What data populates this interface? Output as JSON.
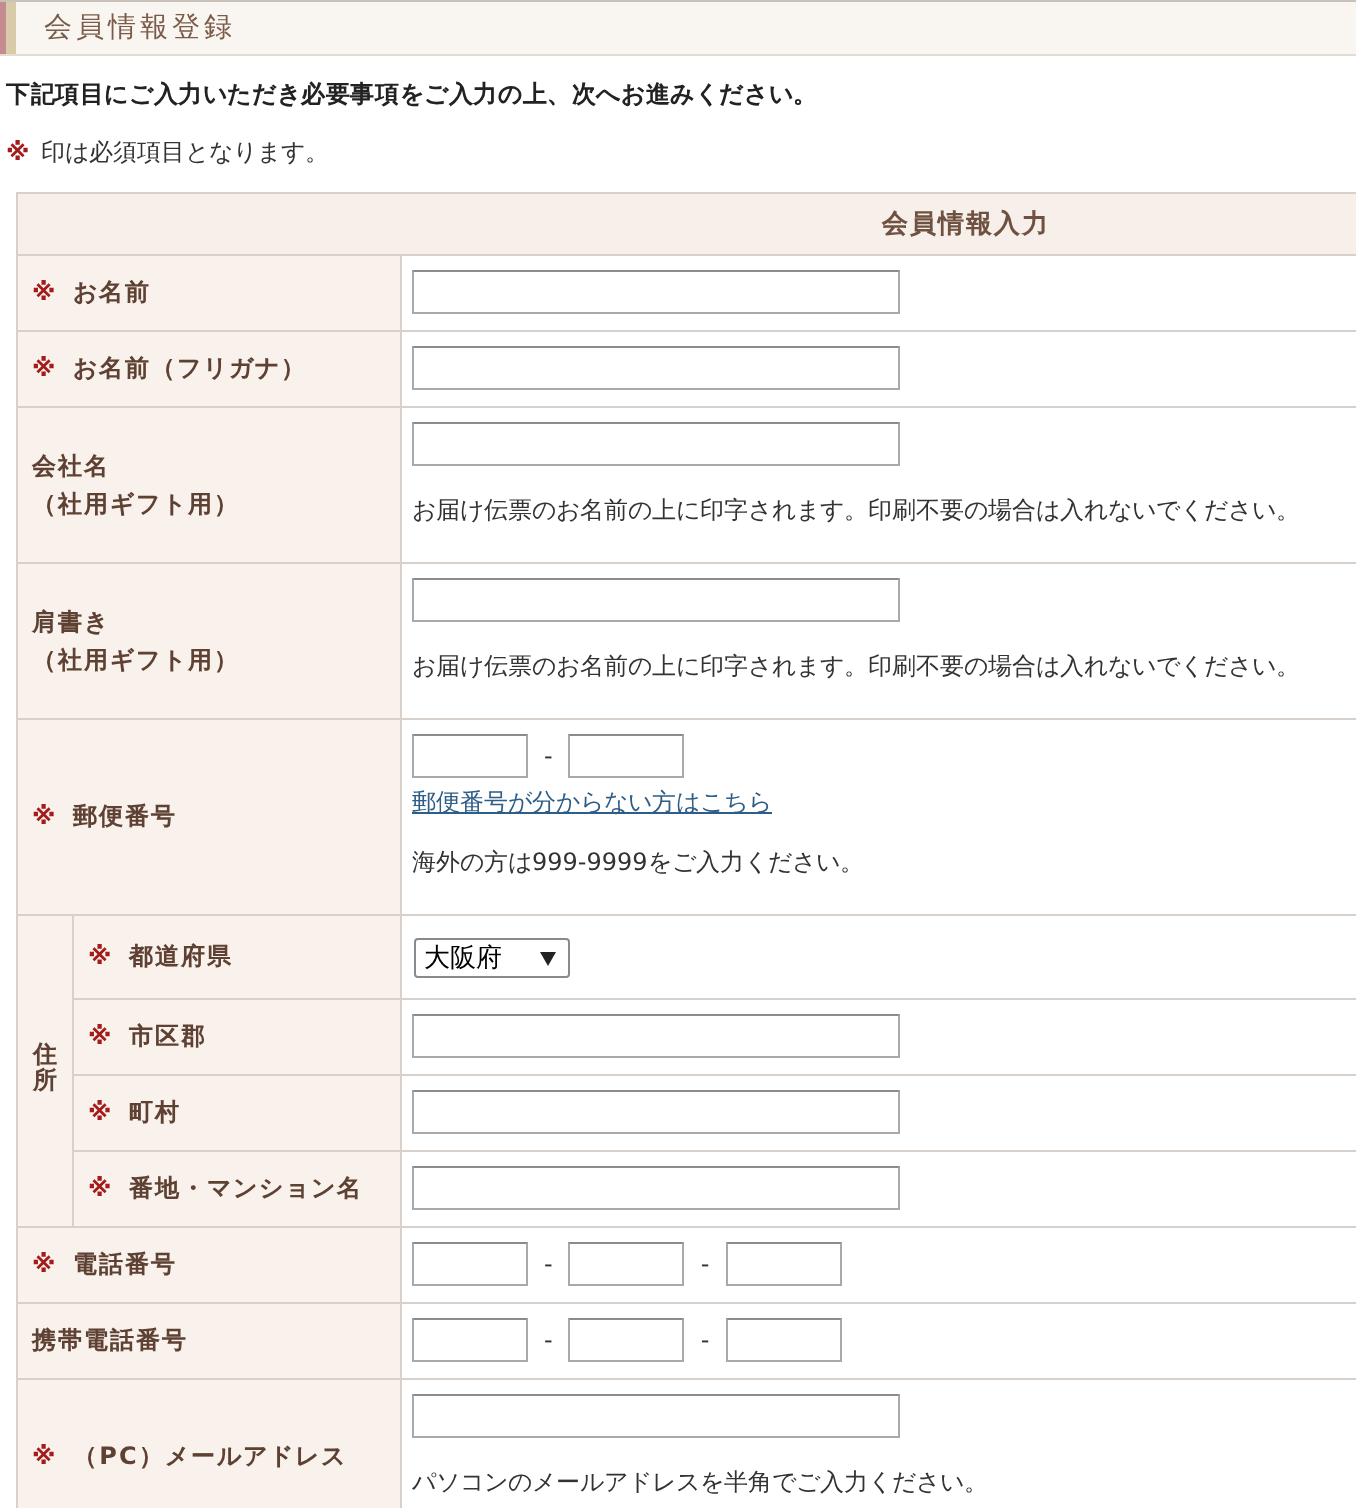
{
  "page_header": {
    "title": "会員情報登録"
  },
  "intro": "下記項目にご入力いただき必要事項をご入力の上、次へお進みください。",
  "required_note": {
    "mark": "※",
    "text": "印は必須項目となります。"
  },
  "form": {
    "heading": "会員情報入力",
    "rows": [
      {
        "kind": "text",
        "required_mark": "※",
        "label": "お名前"
      },
      {
        "kind": "text",
        "required_mark": "※",
        "label": "お名前（フリガナ）"
      },
      {
        "kind": "text",
        "label": "会社名",
        "sublabel": "（社用ギフト用）",
        "note": "お届け伝票のお名前の上に印字されます。印刷不要の場合は入れないでください。"
      },
      {
        "kind": "text",
        "label": "肩書き",
        "sublabel": "（社用ギフト用）",
        "note": "お届け伝票のお名前の上に印字されます。印刷不要の場合は入れないでください。"
      },
      {
        "kind": "split",
        "required_mark": "※",
        "label": "郵便番号",
        "separators": [
          "-"
        ],
        "link": "郵便番号が分からない方はこちら",
        "note": "海外の方は999-9999をご入力ください。"
      },
      {
        "kind": "group",
        "label": "住所",
        "children": [
          {
            "kind": "select",
            "required_mark": "※",
            "label": "都道府県",
            "value": "大阪府"
          },
          {
            "kind": "text",
            "required_mark": "※",
            "label": "市区郡"
          },
          {
            "kind": "text",
            "required_mark": "※",
            "label": "町村"
          },
          {
            "kind": "text",
            "required_mark": "※",
            "label": "番地・マンション名"
          }
        ]
      },
      {
        "kind": "split",
        "required_mark": "※",
        "label": "電話番号",
        "separators": [
          "-",
          "-"
        ]
      },
      {
        "kind": "split",
        "label": "携帯電話番号",
        "separators": [
          "-",
          "-"
        ]
      },
      {
        "kind": "text",
        "required_mark": "※",
        "label": "（PC）メールアドレス",
        "note": "パソコンのメールアドレスを半角でご入力ください。"
      }
    ]
  }
}
